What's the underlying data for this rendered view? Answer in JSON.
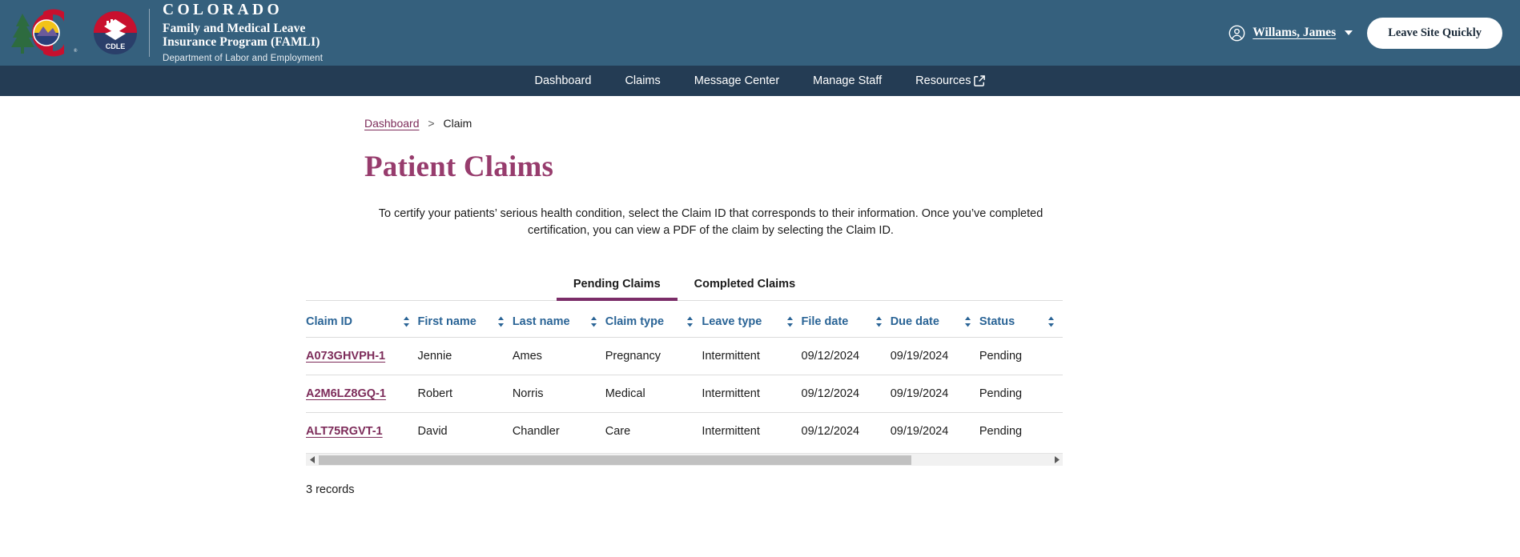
{
  "banner": {
    "state_name": "COLORADO",
    "program_line1": "Family and Medical Leave",
    "program_line2": "Insurance Program (FAMLI)",
    "department": "Department of Labor and Employment",
    "logo_colorado_alt": "colorado-c-logo",
    "logo_cdle_alt": "cdle-logo",
    "cdle_label": "CDLE",
    "user_icon": "user-circle-icon",
    "user_name": "Willams, James",
    "caret_icon": "chevron-down-icon",
    "leave_button": "Leave Site Quickly",
    "background_color": "#35607d"
  },
  "nav": {
    "background_color": "#243c54",
    "items": [
      {
        "label": "Dashboard",
        "external": false
      },
      {
        "label": "Claims",
        "external": false
      },
      {
        "label": "Message Center",
        "external": false
      },
      {
        "label": "Manage Staff",
        "external": false
      },
      {
        "label": "Resources",
        "external": true,
        "icon": "external-link-icon"
      }
    ]
  },
  "breadcrumb": {
    "link": "Dashboard",
    "separator": ">",
    "current": "Claim"
  },
  "page": {
    "title": "Patient Claims",
    "title_color": "#973c6d",
    "description": "To certify your patients’ serious health condition, select the Claim ID that corresponds to their information. Once you’ve completed certification, you can view a PDF of the claim by selecting the Claim ID."
  },
  "tabs": {
    "active_index": 0,
    "active_color": "#7b2d68",
    "items": [
      {
        "label": "Pending Claims"
      },
      {
        "label": "Completed Claims"
      }
    ]
  },
  "table": {
    "sort_icon": "sort-arrows-icon",
    "header_color": "#2a6496",
    "link_color": "#7d2c5a",
    "columns": [
      {
        "label": "Claim ID",
        "sortable": true
      },
      {
        "label": "First name",
        "sortable": true
      },
      {
        "label": "Last name",
        "sortable": true
      },
      {
        "label": "Claim type",
        "sortable": true
      },
      {
        "label": "Leave type",
        "sortable": true
      },
      {
        "label": "File date",
        "sortable": true
      },
      {
        "label": "Due date",
        "sortable": true
      },
      {
        "label": "Status",
        "sortable": true
      }
    ],
    "rows": [
      {
        "claim_id": "A073GHVPH-1",
        "first_name": "Jennie",
        "last_name": "Ames",
        "claim_type": "Pregnancy",
        "leave_type": "Intermittent",
        "file_date": "09/12/2024",
        "due_date": "09/19/2024",
        "status": "Pending"
      },
      {
        "claim_id": "A2M6LZ8GQ-1",
        "first_name": "Robert",
        "last_name": "Norris",
        "claim_type": "Medical",
        "leave_type": "Intermittent",
        "file_date": "09/12/2024",
        "due_date": "09/19/2024",
        "status": "Pending"
      },
      {
        "claim_id": "ALT75RGVT-1",
        "first_name": "David",
        "last_name": "Chandler",
        "claim_type": "Care",
        "leave_type": "Intermittent",
        "file_date": "09/12/2024",
        "due_date": "09/19/2024",
        "status": "Pending"
      }
    ],
    "scrollbar": {
      "left_arrow_icon": "scroll-left-arrow-icon",
      "right_arrow_icon": "scroll-right-arrow-icon"
    },
    "record_count_label": "3 records"
  }
}
